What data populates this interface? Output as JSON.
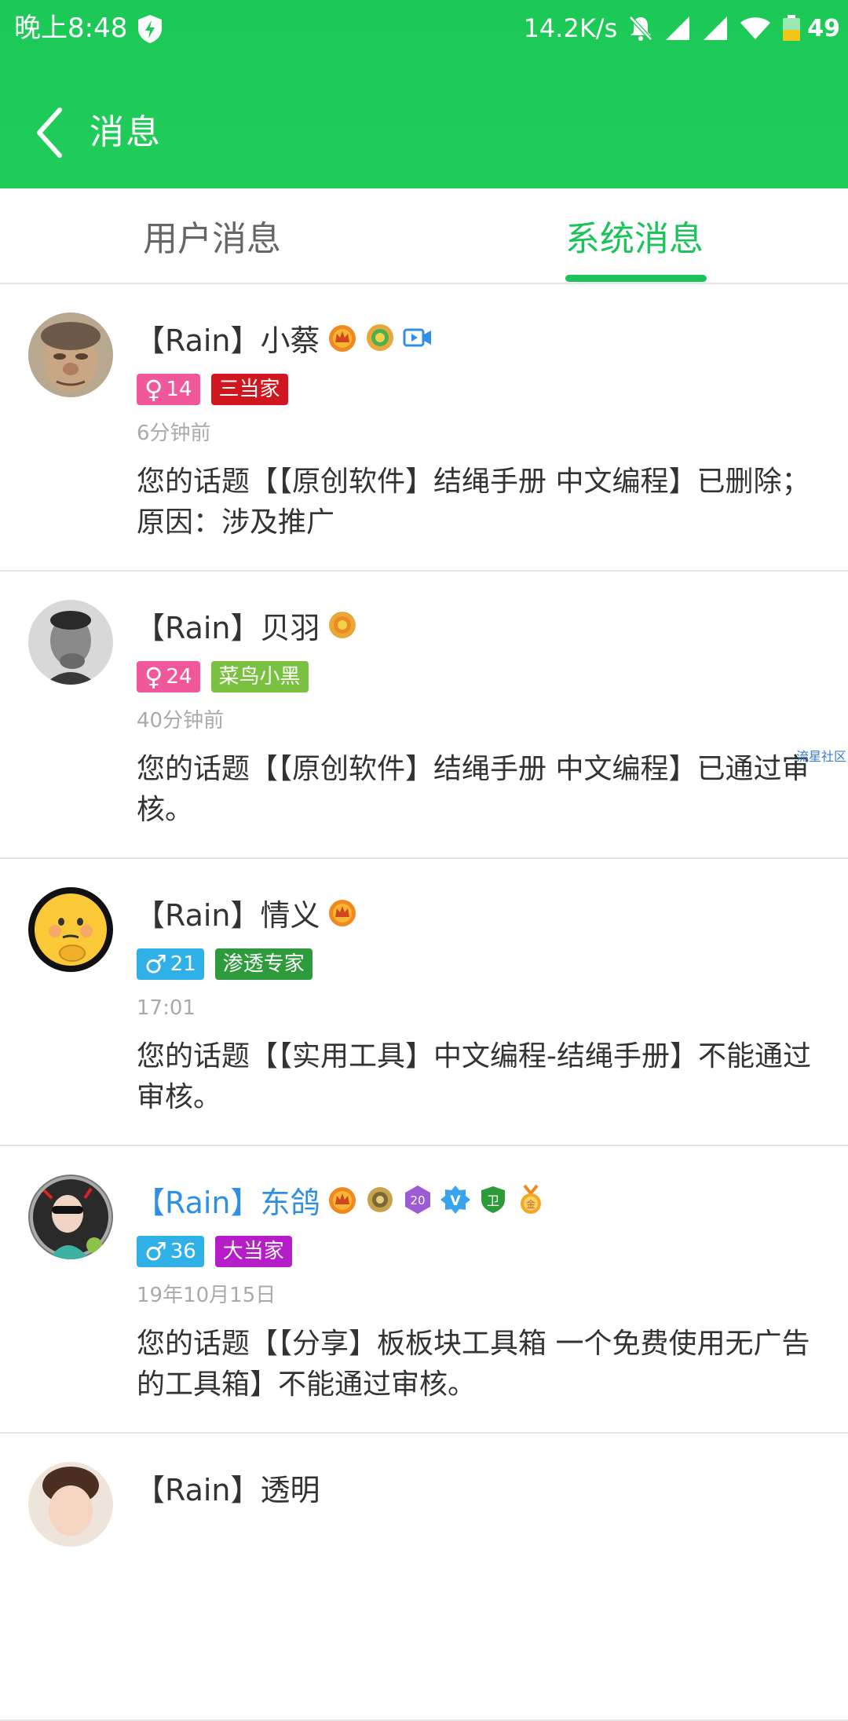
{
  "status_bar": {
    "time": "晚上8:48",
    "net_speed": "14.2K/s",
    "battery": "49"
  },
  "app_bar": {
    "title": "消息"
  },
  "tabs": [
    {
      "label": "用户消息",
      "active": false
    },
    {
      "label": "系统消息",
      "active": true
    }
  ],
  "colors": {
    "brand_green": "#1dc956",
    "female_tag": "#f0589b",
    "male_tag": "#2fb0e6",
    "link_blue": "#2f8ee6"
  },
  "messages": [
    {
      "name": "【Rain】小蔡",
      "icons": [
        "crown-medal-icon",
        "laurel-medal-icon",
        "video-icon"
      ],
      "gender": "♀",
      "level": "14",
      "title_tag": "三当家",
      "title_color": "#d0161e",
      "time": "6分钟前",
      "content": "您的话题【【原创软件】结绳手册 中文编程】已删除；原因：涉及推广"
    },
    {
      "name": "【Rain】贝羽",
      "icons": [
        "laurel-medal-icon"
      ],
      "gender": "♀",
      "level": "24",
      "title_tag": "菜鸟小黑",
      "title_color": "#7ac142",
      "time": "40分钟前",
      "content": "您的话题【【原创软件】结绳手册 中文编程】已通过审核。"
    },
    {
      "name": "【Rain】情义",
      "icons": [
        "crown-medal-icon"
      ],
      "gender": "♂",
      "level": "21",
      "title_tag": "渗透专家",
      "title_color": "#2d9a3c",
      "time": "17:01",
      "content": "您的话题【【实用工具】中文编程-结绳手册】不能通过审核。"
    },
    {
      "name": "【Rain】东鸽",
      "icons": [
        "crown-medal-icon",
        "round-medal-icon",
        "twenty-badge-icon",
        "verified-v-icon",
        "guard-shield-icon",
        "gold-medal-icon"
      ],
      "gender": "♂",
      "level": "36",
      "title_tag": "大当家",
      "title_color": "#b61cc8",
      "time": "19年10月15日",
      "content": "您的话题【【分享】板板块工具箱 一个免费使用无广告的工具箱】不能通过审核。"
    },
    {
      "name": "【Rain】透明"
    }
  ],
  "watermark": "流星社区",
  "icon_texts": {
    "twenty": "20",
    "v": "V",
    "guard": "卫",
    "gold": "金"
  }
}
